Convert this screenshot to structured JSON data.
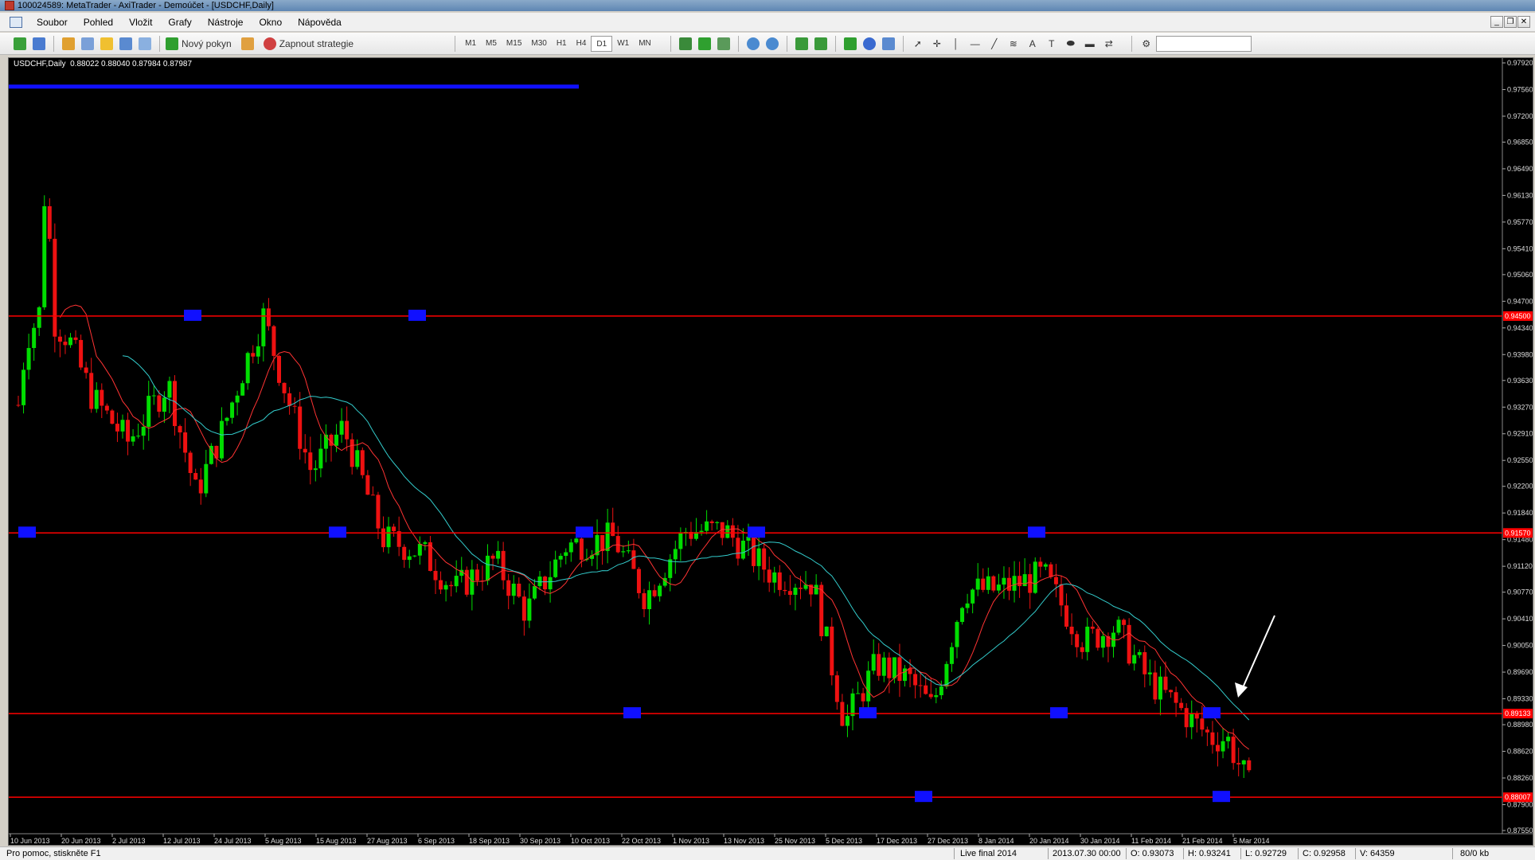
{
  "window": {
    "title": "100024589: MetaTrader - AxiTrader - Demoúčet - [USDCHF,Daily]"
  },
  "menu": {
    "items": [
      "Soubor",
      "Pohled",
      "Vložit",
      "Grafy",
      "Nástroje",
      "Okno",
      "Nápověda"
    ]
  },
  "toolbar": {
    "new_order_label": "Nový pokyn",
    "strategy_label": "Zapnout strategie",
    "timeframes": [
      "M1",
      "M5",
      "M15",
      "M30",
      "H1",
      "H4",
      "D1",
      "W1",
      "MN"
    ],
    "active_timeframe": "D1"
  },
  "chart": {
    "header": "USDCHF,Daily  0.88022 0.88040 0.87984 0.87987",
    "background": "#000000",
    "bull_color": "#00dd00",
    "bear_color": "#ee1111",
    "ma_fast_color": "#ff3333",
    "ma_slow_color": "#33cccc",
    "hline_color": "#ff0000",
    "zone_color": "#1010ff",
    "y_ticks": [
      "0.97920",
      "0.97560",
      "0.97200",
      "0.96850",
      "0.96490",
      "0.96130",
      "0.95770",
      "0.95410",
      "0.95060",
      "0.94700",
      "0.94340",
      "0.93980",
      "0.93630",
      "0.93270",
      "0.92910",
      "0.92550",
      "0.92200",
      "0.91840",
      "0.91480",
      "0.91120",
      "0.90770",
      "0.90410",
      "0.90050",
      "0.89690",
      "0.89330",
      "0.88980",
      "0.88620",
      "0.88260",
      "0.87900",
      "0.87550"
    ],
    "x_labels": [
      "10 Jun 2013",
      "20 Jun 2013",
      "2 Jul 2013",
      "12 Jul 2013",
      "24 Jul 2013",
      "5 Aug 2013",
      "15 Aug 2013",
      "27 Aug 2013",
      "6 Sep 2013",
      "18 Sep 2013",
      "30 Sep 2013",
      "10 Oct 2013",
      "22 Oct 2013",
      "1 Nov 2013",
      "13 Nov 2013",
      "25 Nov 2013",
      "5 Dec 2013",
      "17 Dec 2013",
      "27 Dec 2013",
      "8 Jan 2014",
      "20 Jan 2014",
      "30 Jan 2014",
      "11 Feb 2014",
      "21 Feb 2014",
      "5 Mar 2014"
    ],
    "hlines": [
      {
        "price": 0.945,
        "label": "0.94500"
      },
      {
        "price": 0.9157,
        "label": "0.91570"
      },
      {
        "price": 0.8913,
        "label": "0.89133"
      },
      {
        "price": 0.88,
        "label": "0.88007"
      }
    ]
  },
  "status": {
    "help": "Pro pomoc, stiskněte F1",
    "profile": "Live final 2014",
    "datetime": "2013.07.30 00:00",
    "open": "O: 0.93073",
    "high": "H: 0.93241",
    "low": "L: 0.92729",
    "close": "C: 0.92958",
    "volume": "V: 64359",
    "traffic": "80/0 kb"
  }
}
